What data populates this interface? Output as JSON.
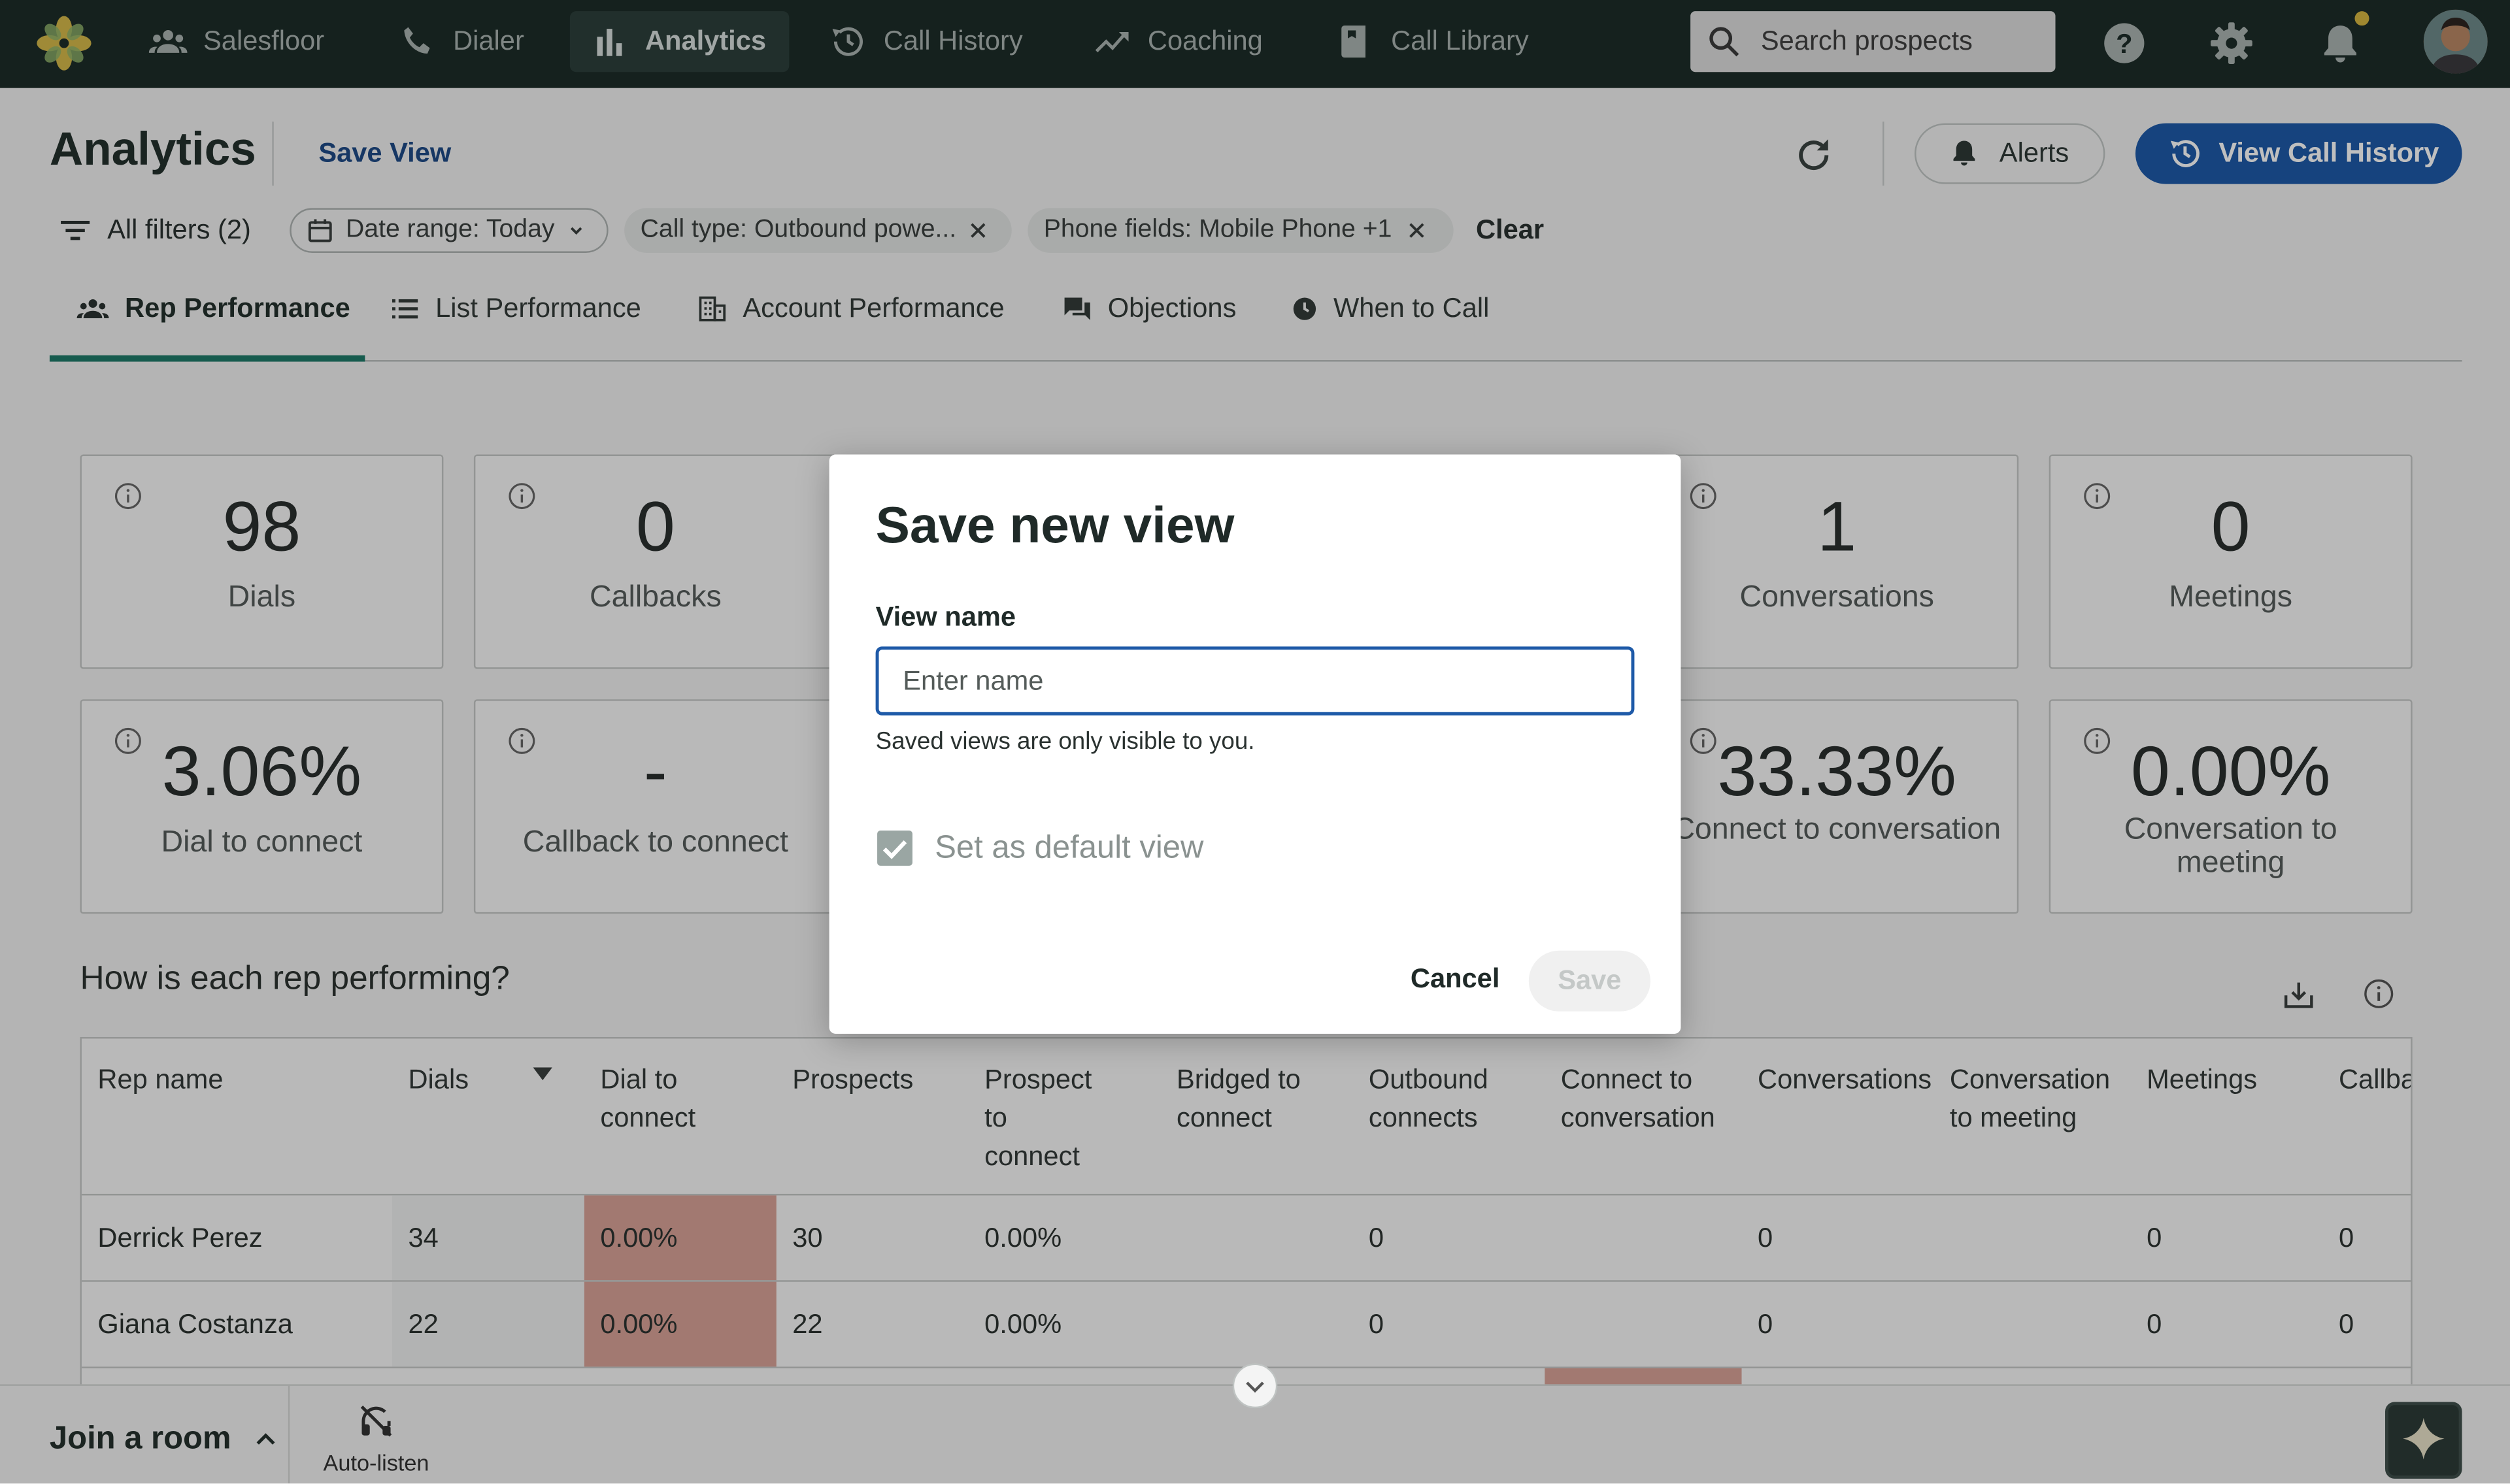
{
  "nav": {
    "items": [
      {
        "label": "Salesfloor"
      },
      {
        "label": "Dialer"
      },
      {
        "label": "Analytics"
      },
      {
        "label": "Call History"
      },
      {
        "label": "Coaching"
      },
      {
        "label": "Call Library"
      }
    ],
    "search_placeholder": "Search prospects",
    "accent_color": "#1d2c29"
  },
  "header": {
    "title": "Analytics",
    "save_view": "Save View",
    "alerts": "Alerts",
    "view_call_history": "View Call History"
  },
  "filters": {
    "all_filters": "All filters (2)",
    "date_range": "Date range: Today",
    "call_type": "Call type: Outbound powe...",
    "phone_fields": "Phone fields: Mobile Phone +1",
    "clear": "Clear"
  },
  "tabs": [
    {
      "label": "Rep Performance",
      "icon": "people-icon",
      "active": true
    },
    {
      "label": "List Performance",
      "icon": "list-icon"
    },
    {
      "label": "Account Performance",
      "icon": "building-icon"
    },
    {
      "label": "Objections",
      "icon": "chat-icon"
    },
    {
      "label": "When to Call",
      "icon": "clock-icon"
    }
  ],
  "stats": [
    {
      "value": "98",
      "label": "Dials"
    },
    {
      "value": "0",
      "label": "Callbacks"
    },
    {
      "value": "1",
      "label": "Conversations"
    },
    {
      "value": "0",
      "label": "Meetings"
    },
    {
      "value": "3.06%",
      "label": "Dial to connect"
    },
    {
      "value": "-",
      "label": "Callback to connect"
    },
    {
      "value": "33.33%",
      "label": "Connect to conversation"
    },
    {
      "value": "0.00%",
      "label": "Conversation to meeting"
    }
  ],
  "section": {
    "title": "How is each rep performing?"
  },
  "table": {
    "headers": [
      "Rep name",
      "Dials",
      "Dial to connect",
      "Prospects",
      "Prospect to connect",
      "Bridged to connect",
      "Outbound connects",
      "Connect to conversation",
      "Conversations",
      "Conversation to meeting",
      "Meetings",
      "Callba"
    ],
    "rows": [
      {
        "name": "Derrick Perez",
        "dials": "34",
        "dial_to_connect": "0.00%",
        "prospects": "30",
        "prospect_to_connect": "0.00%",
        "outbound_connects": "0",
        "conversations": "0",
        "meetings": "0",
        "callbacks": "0"
      },
      {
        "name": "Giana Costanza",
        "dials": "22",
        "dial_to_connect": "0.00%",
        "prospects": "22",
        "prospect_to_connect": "0.00%",
        "outbound_connects": "0",
        "conversations": "0",
        "meetings": "0",
        "callbacks": "0"
      }
    ],
    "heat_color": "#d9a297"
  },
  "bottom": {
    "join_room": "Join a room",
    "auto_listen": "Auto-listen"
  },
  "modal": {
    "title": "Save new view",
    "field_label": "View name",
    "placeholder": "Enter name",
    "value": "",
    "helper": "Saved views are only visible to you.",
    "checkbox_label": "Set as default view",
    "checkbox_checked": true,
    "cancel": "Cancel",
    "save": "Save"
  }
}
